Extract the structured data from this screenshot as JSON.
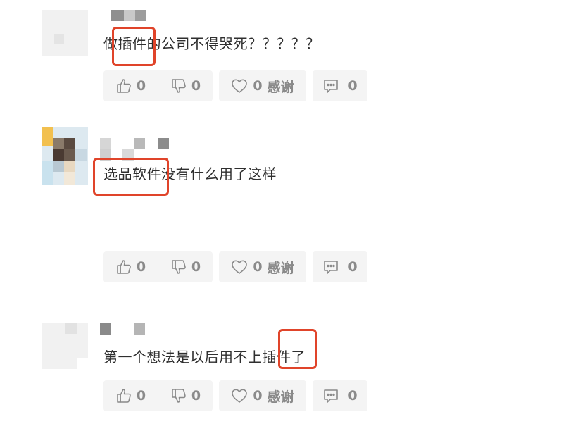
{
  "comments": [
    {
      "text": "做插件的公司不得哭死？？？？？",
      "highlight_word": "插件",
      "actions": {
        "like_count": "0",
        "dislike_count": "0",
        "thanks_count": "0",
        "thanks_label": "感谢",
        "reply_count": "0"
      }
    },
    {
      "text": "选品软件没有什么用了这样",
      "highlight_word": "软件",
      "actions": {
        "like_count": "0",
        "dislike_count": "0",
        "thanks_count": "0",
        "thanks_label": "感谢",
        "reply_count": "0"
      }
    },
    {
      "text": "第一个想法是以后用不上插件了",
      "highlight_word": "插件",
      "actions": {
        "like_count": "0",
        "dislike_count": "0",
        "thanks_count": "0",
        "thanks_label": "感谢",
        "reply_count": "0"
      }
    }
  ],
  "icons": {
    "like": "thumbs-up-icon",
    "dislike": "thumbs-down-icon",
    "thanks": "heart-icon",
    "reply": "comment-icon"
  },
  "colors": {
    "highlight_border": "#e0442a",
    "button_bg": "#f4f4f4",
    "button_text": "#8a8a8a"
  }
}
